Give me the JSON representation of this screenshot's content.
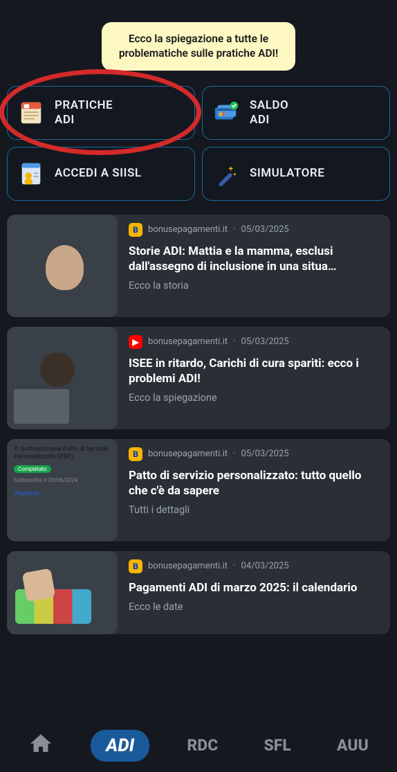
{
  "banner": {
    "text": "Ecco la spiegazione a tutte le problematiche sulle pratiche ADI!"
  },
  "tiles": {
    "pratiche": {
      "line1": "PRATICHE",
      "line2": "ADI"
    },
    "saldo": {
      "line1": "SALDO",
      "line2": "ADI"
    },
    "siisl": {
      "line1": "ACCEDI A SIISL",
      "line2": ""
    },
    "simulatore": {
      "line1": "SIMULATORE",
      "line2": ""
    }
  },
  "feed": [
    {
      "source": "bonusepagamenti.it",
      "date": "05/03/2025",
      "src_icon": "b",
      "title": "Storie ADI: Mattia e la mamma, esclusi dall'assegno di inclusione in una situa…",
      "subtitle": "Ecco la storia"
    },
    {
      "source": "bonusepagamenti.it",
      "date": "05/03/2025",
      "src_icon": "yt",
      "title": "ISEE in ritardo, Carichi di cura spariti: ecco i problemi ADI!",
      "subtitle": "Ecco la spiegazione"
    },
    {
      "source": "bonusepagamenti.it",
      "date": "05/03/2025",
      "src_icon": "b",
      "title": "Patto di servizio personalizzato: tutto quello che c'è da sapere",
      "subtitle": "Tutti i dettagli"
    },
    {
      "source": "bonusepagamenti.it",
      "date": "04/03/2025",
      "src_icon": "b",
      "title": "Pagamenti ADI di marzo 2025: il calendario",
      "subtitle": "Ecco le date"
    }
  ],
  "thumb3": {
    "title": "7. Sottoscrizione Patto di Servizio Personalizzato (PSP)",
    "badge": "Completato",
    "sub": "Sottoscritto il 20/06/2024",
    "link": "Visualizza →"
  },
  "nav": {
    "adi": "ADI",
    "rdc": "RDC",
    "sfl": "SFL",
    "auu": "AUU"
  }
}
